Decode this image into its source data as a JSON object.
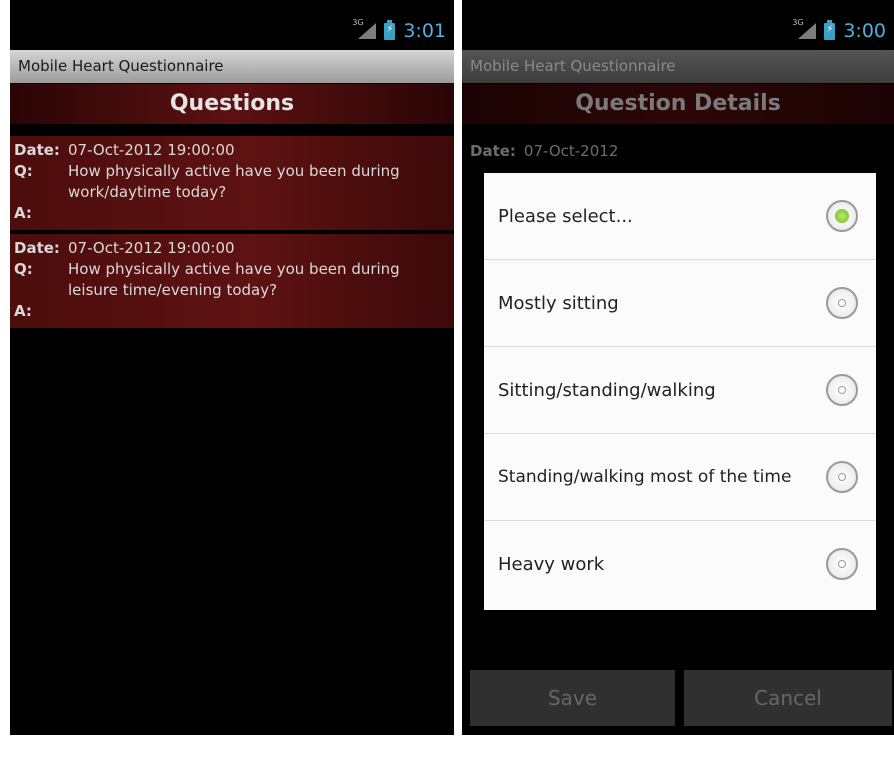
{
  "left": {
    "status": {
      "clock": "3:01",
      "network": "3G"
    },
    "app_title": "Mobile Heart Questionnaire",
    "header": "Questions",
    "labels": {
      "date": "Date:",
      "q": "Q:",
      "a": "A:"
    },
    "items": [
      {
        "date": "07-Oct-2012 19:00:00",
        "question": "How physically active have you been during work/daytime today?",
        "answer": ""
      },
      {
        "date": "07-Oct-2012 19:00:00",
        "question": "How physically active have you been during leisure time/evening today?",
        "answer": ""
      }
    ]
  },
  "right": {
    "status": {
      "clock": "3:00",
      "network": "3G"
    },
    "app_title": "Mobile Heart Questionnaire",
    "header": "Question Details",
    "date_label": "Date:",
    "date_value": "07-Oct-2012",
    "options": [
      {
        "label": "Please select...",
        "selected": true
      },
      {
        "label": "Mostly sitting",
        "selected": false
      },
      {
        "label": "Sitting/standing/walking",
        "selected": false
      },
      {
        "label": "Standing/walking most of the time",
        "selected": false
      },
      {
        "label": "Heavy work",
        "selected": false
      }
    ],
    "save_label": "Save",
    "cancel_label": "Cancel"
  },
  "colors": {
    "accent": "#4eb0dc",
    "header_red": "#5c1111",
    "radio_selected": "#7cc832"
  }
}
